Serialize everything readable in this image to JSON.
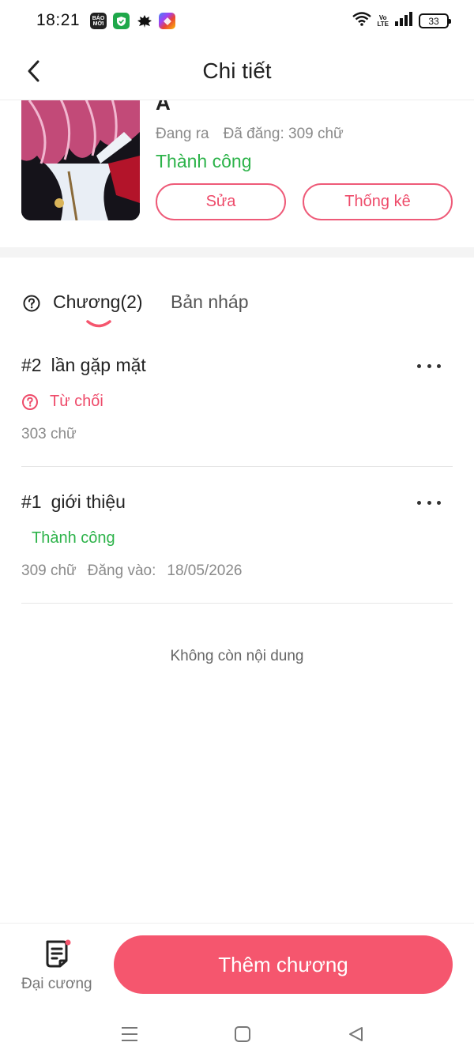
{
  "status_bar": {
    "time": "18:21",
    "notif_icons": [
      {
        "name": "baomoi-app-icon",
        "label_top": "BÁO",
        "label_bottom": "MỚI"
      },
      {
        "name": "shield-app-icon"
      },
      {
        "name": "leaf-app-icon"
      },
      {
        "name": "photos-app-icon"
      }
    ],
    "volte_top": "Vo",
    "volte_bottom": "LTE",
    "battery_level": "33"
  },
  "header": {
    "title": "Chi tiết",
    "back_icon": "chevron-left-icon"
  },
  "book": {
    "title": "A",
    "state": "Đang ra",
    "published": "Đã đăng: 309 chữ",
    "status": "Thành công",
    "edit_label": "Sửa",
    "stats_label": "Thống kê"
  },
  "tabs": {
    "chapters_label": "Chương(2)",
    "drafts_label": "Bản nháp"
  },
  "chapters": [
    {
      "number": "#2",
      "title": "lần gặp mặt",
      "status": "Từ chối",
      "words": "303 chữ"
    },
    {
      "number": "#1",
      "title": "giới thiệu",
      "status": "Thành công",
      "words": "309 chữ",
      "date_label": "Đăng vào:",
      "date": "18/05/2026"
    }
  ],
  "empty_note": "Không còn nội dung",
  "bottom_bar": {
    "outline_label": "Đại cương",
    "add_chapter_label": "Thêm chương"
  },
  "colors": {
    "accent": "#f5566e",
    "success": "#2db34a",
    "reject": "#ee4b6a"
  }
}
